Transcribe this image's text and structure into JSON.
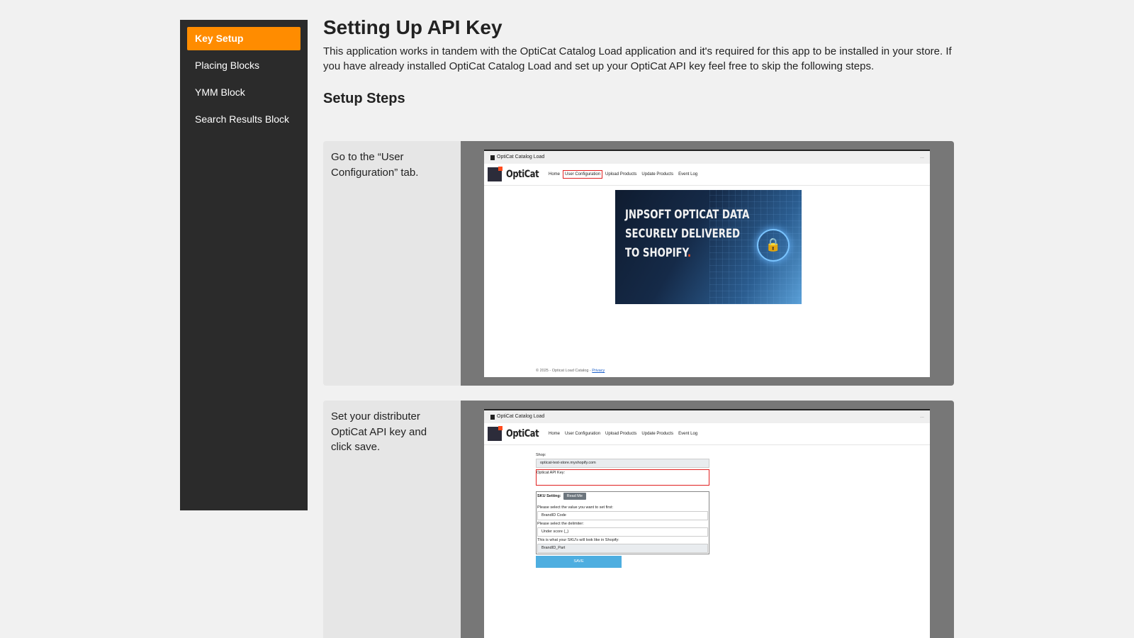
{
  "sidebar": {
    "items": [
      {
        "label": "Key Setup",
        "active": true
      },
      {
        "label": "Placing Blocks",
        "active": false
      },
      {
        "label": "YMM Block",
        "active": false
      },
      {
        "label": "Search Results Block",
        "active": false
      }
    ]
  },
  "page": {
    "title": "Setting Up API Key",
    "intro": "This application works in tandem with the OptiCat Catalog Load application and it's required for this app to be installed in your store. If you have already installed OptiCat Catalog Load and set up your OptiCat API key feel free to skip the following steps.",
    "section_title": "Setup Steps"
  },
  "steps": [
    {
      "text": "Go to the “User Configuration” tab.",
      "screenshot": {
        "window_title": "OptiCat Catalog Load",
        "dots": "...",
        "brand": "OptiCat",
        "nav": [
          "Home",
          "User Configuration",
          "Upload Products",
          "Update Products",
          "Event Log"
        ],
        "highlighted_nav": "User Configuration",
        "hero_lines": [
          "JNPSOFT OPTICAT DATA",
          "SECURELY DELIVERED",
          "TO SHOPIFY"
        ],
        "hero_dot": ".",
        "footer": "© 2025 - Opticat Load Catalog -",
        "footer_link": "Privacy"
      }
    },
    {
      "text": "Set your distributer OptiCat API key and click save.",
      "screenshot": {
        "window_title": "OptiCat Catalog Load",
        "dots": "...",
        "brand": "OptiCat",
        "nav": [
          "Home",
          "User Configuration",
          "Upload Products",
          "Update Products",
          "Event Log"
        ],
        "form": {
          "shop_label": "Shop:",
          "shop_value": "opticat-test-store.myshopify.com",
          "api_key_label": "Opticat API Key:",
          "api_key_value": "",
          "sku_label": "SKU Setting:",
          "readme_label": "Read Me",
          "first_label": "Please select the value you want to set first:",
          "first_value": "BrandID Code",
          "delim_label": "Please select the delimiter:",
          "delim_value": "Under score (_)",
          "preview_label": "This is what your SKU's will look like in Shopify:",
          "preview_value": "BrandID_Part",
          "save_label": "SAVE"
        }
      }
    }
  ],
  "colors": {
    "accent": "#ff8c00",
    "sidebar_bg": "#2b2b2b",
    "highlight": "#e02020",
    "save_button": "#4eaee0"
  }
}
